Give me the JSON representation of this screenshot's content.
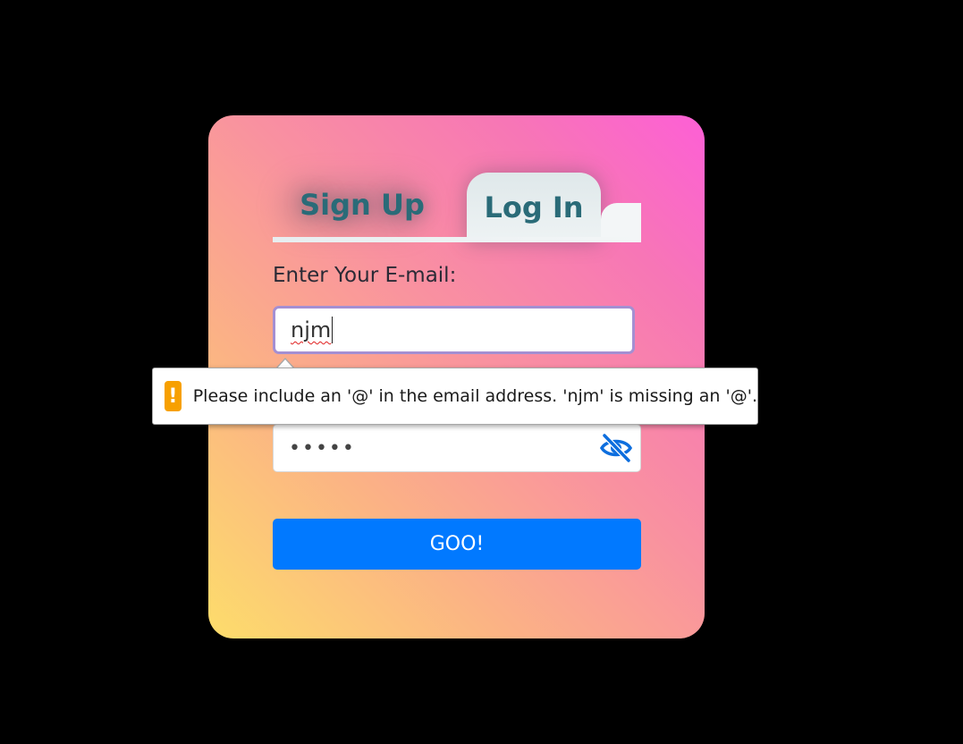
{
  "tabs": {
    "signup_label": "Sign Up",
    "login_label": "Log In",
    "active": "Log In"
  },
  "form": {
    "email_label": "Enter Your E-mail:",
    "email_value": "njm",
    "password_masked": "•••••",
    "submit_label": "GOO!"
  },
  "validation": {
    "message": "Please include an '@' in the email address. 'njm' is missing an '@'.",
    "icon": "!"
  },
  "colors": {
    "accent": "#0179ff",
    "tab_text": "#2a6b78",
    "warning": "#f7a000",
    "focus_border": "#a48fd2"
  },
  "icons": {
    "password_toggle": "eye-slash-icon",
    "warning": "warning-icon"
  }
}
